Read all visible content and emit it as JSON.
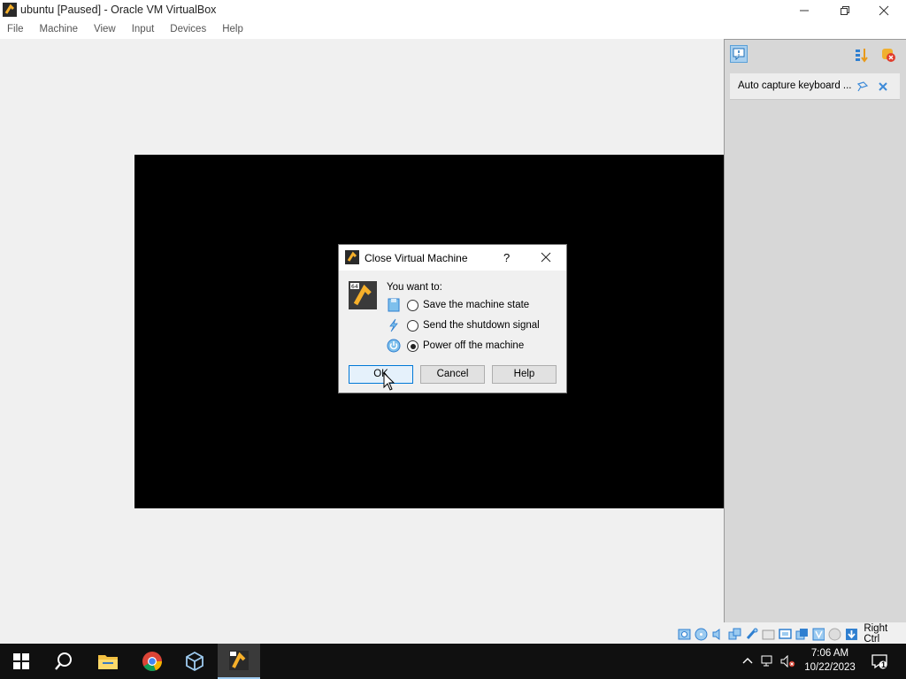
{
  "window": {
    "title": "ubuntu [Paused] - Oracle VM VirtualBox"
  },
  "menu": [
    "File",
    "Machine",
    "View",
    "Input",
    "Devices",
    "Help"
  ],
  "notification": {
    "text": "Auto capture keyboard ..."
  },
  "dialog": {
    "title": "Close Virtual Machine",
    "help_glyph": "?",
    "prompt": "You want to:",
    "options": [
      {
        "label": "Save the machine state",
        "checked": false
      },
      {
        "label": "Send the shutdown signal",
        "checked": false
      },
      {
        "label": "Power off the machine",
        "checked": true
      }
    ],
    "buttons": {
      "ok": "OK",
      "cancel": "Cancel",
      "help": "Help"
    }
  },
  "statusbar": {
    "host_key": "Right Ctrl"
  },
  "taskbar": {
    "time": "7:06 AM",
    "date": "10/22/2023",
    "notification_count": "1"
  },
  "colors": {
    "accent": "#0078d7",
    "vm_background": "#000000",
    "taskbar": "#101010"
  }
}
